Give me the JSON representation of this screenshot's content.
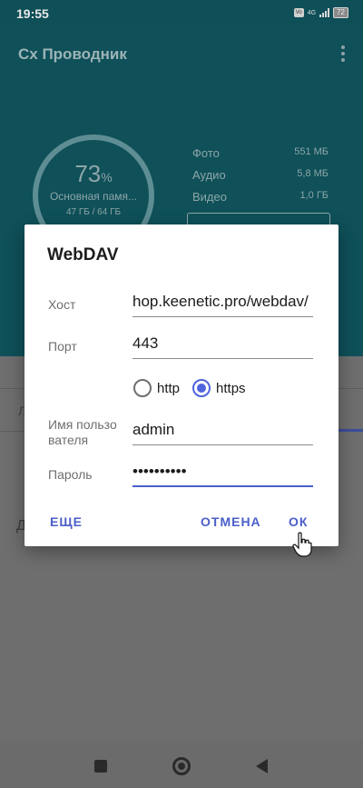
{
  "status_bar": {
    "time": "19:55",
    "network": "4G",
    "battery": "72"
  },
  "app": {
    "title": "Cx Проводник",
    "storage": {
      "percent": "73",
      "percent_sign": "%",
      "label": "Основная памя...",
      "size": "47 ГБ / 64 ГБ"
    },
    "stats": [
      {
        "name": "Фото",
        "value": "551 МБ"
      },
      {
        "name": "Аудио",
        "value": "5,8 МБ"
      },
      {
        "name": "Видео",
        "value": "1,0 ГБ"
      }
    ],
    "tab_letter": "Л",
    "body_letter": "Д"
  },
  "dialog": {
    "title": "WebDAV",
    "host_label": "Хост",
    "host_value": "hop.keenetic.pro/webdav/",
    "port_label": "Порт",
    "port_value": "443",
    "protocols": [
      {
        "label": "http",
        "checked": false
      },
      {
        "label": "https",
        "checked": true
      }
    ],
    "username_label": "Имя пользо\nвателя",
    "username_value": "admin",
    "password_label": "Пароль",
    "password_value": "••••••••••",
    "more_button": "ЕЩЕ",
    "cancel_button": "ОТМЕНА",
    "ok_button": "ОК"
  },
  "colors": {
    "accent": "#4a5ec9",
    "header": "#0f5059"
  }
}
